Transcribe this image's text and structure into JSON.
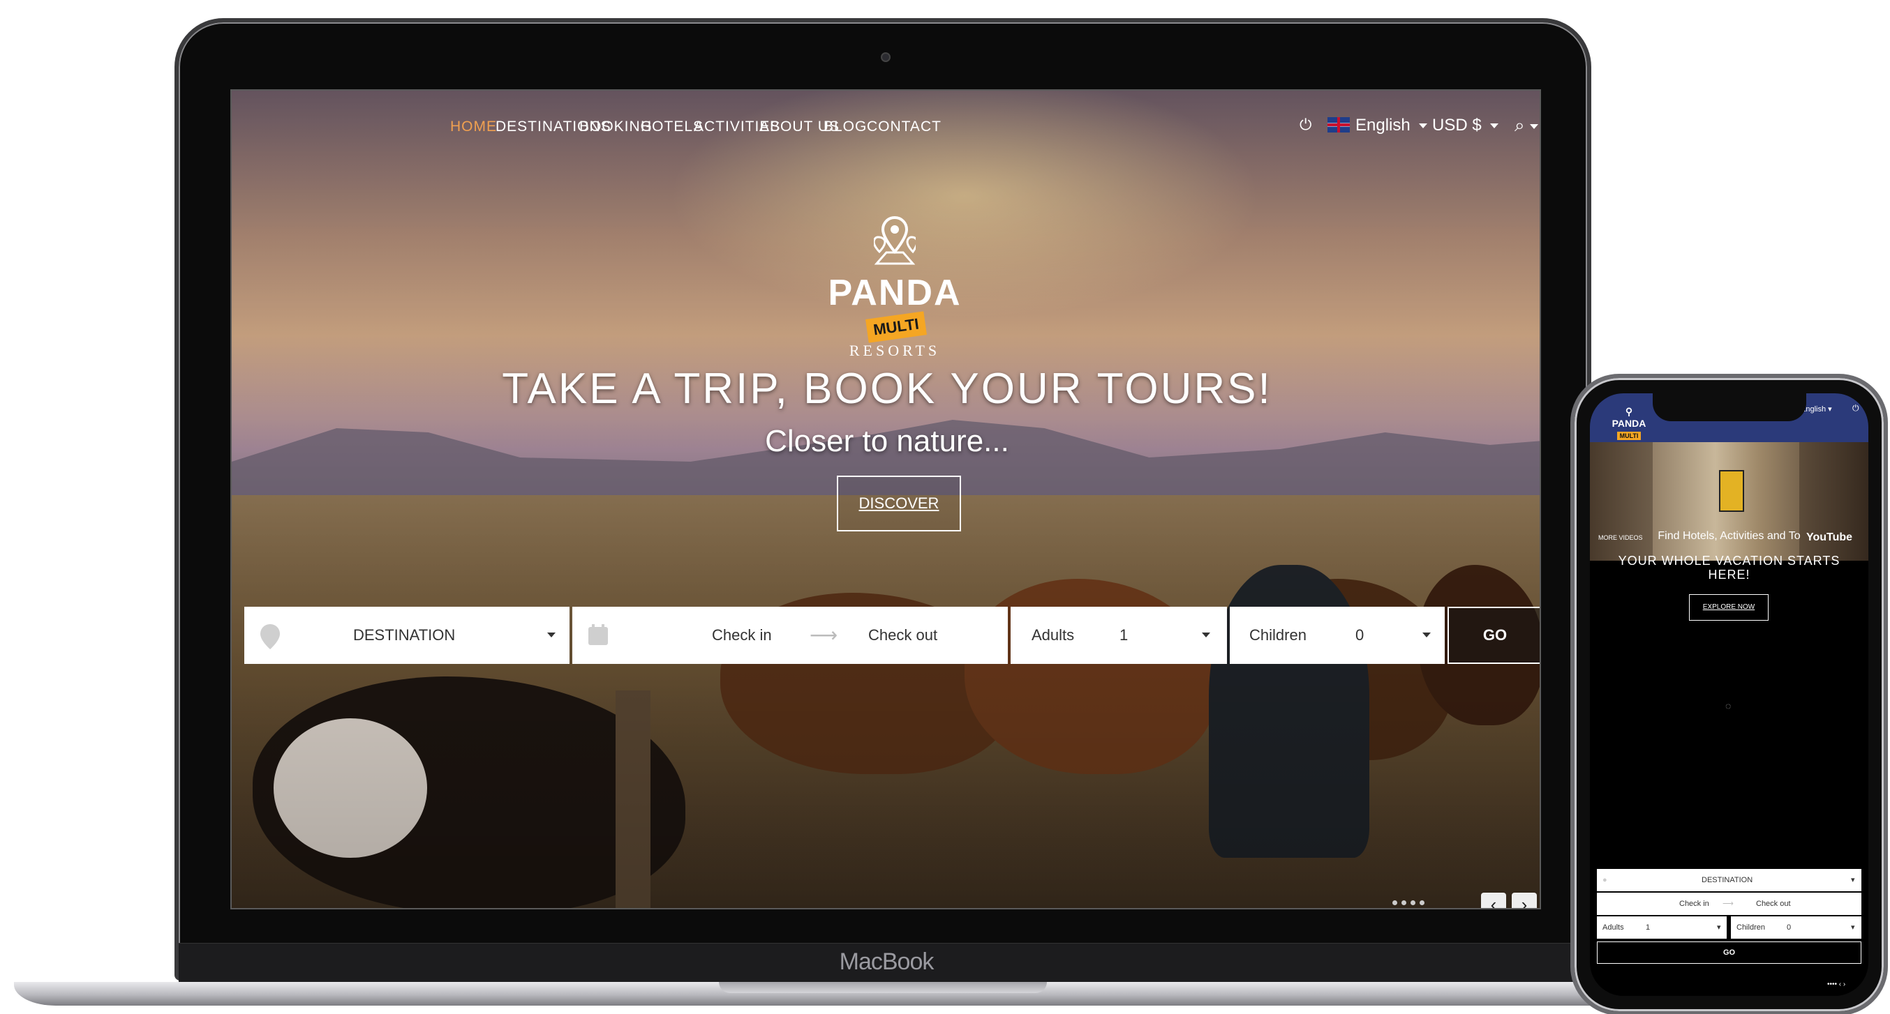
{
  "laptop": {
    "brand": "MacBook"
  },
  "desktop": {
    "nav": {
      "items": [
        {
          "label": "HOME",
          "active": true
        },
        {
          "label": "DESTINATIONS",
          "active": false
        },
        {
          "label": "BOOKING",
          "active": false
        },
        {
          "label": "HOTELS",
          "active": false
        },
        {
          "label": "ACTIVITIES",
          "active": false
        },
        {
          "label": "ABOUT US",
          "active": false
        },
        {
          "label": "BLOG",
          "active": false
        },
        {
          "label": "CONTACT",
          "active": false
        }
      ],
      "power_icon": "power-icon",
      "language": "English",
      "currency": "USD $",
      "search_icon": "search-icon"
    },
    "logo": {
      "name": "PANDA",
      "tag": "MULTI",
      "sub": "RESORTS"
    },
    "hero": {
      "title": "TAKE A TRIP, BOOK YOUR TOURS!",
      "subtitle": "Closer to nature...",
      "button": "DISCOVER"
    },
    "search": {
      "destination": "DESTINATION",
      "checkin": "Check in",
      "checkout": "Check out",
      "adults_label": "Adults",
      "adults_value": "1",
      "children_label": "Children",
      "children_value": "0",
      "go": "GO"
    }
  },
  "mobile": {
    "logo": {
      "name": "PANDA",
      "tag": "MULTI"
    },
    "language": "English",
    "video": {
      "caption": "Find Hotels, Activities and To",
      "more": "MORE VIDEOS",
      "youtube": "YouTube"
    },
    "hero": {
      "title": "YOUR WHOLE VACATION STARTS HERE!",
      "button": "EXPLORE NOW"
    },
    "search": {
      "destination": "DESTINATION",
      "checkin": "Check in",
      "checkout": "Check out",
      "adults_label": "Adults",
      "adults_value": "1",
      "children_label": "Children",
      "children_value": "0",
      "go": "GO"
    }
  },
  "colors": {
    "accent": "#f0a050",
    "logo_tag": "#f5a623",
    "mobile_header": "#2b3a7a"
  }
}
